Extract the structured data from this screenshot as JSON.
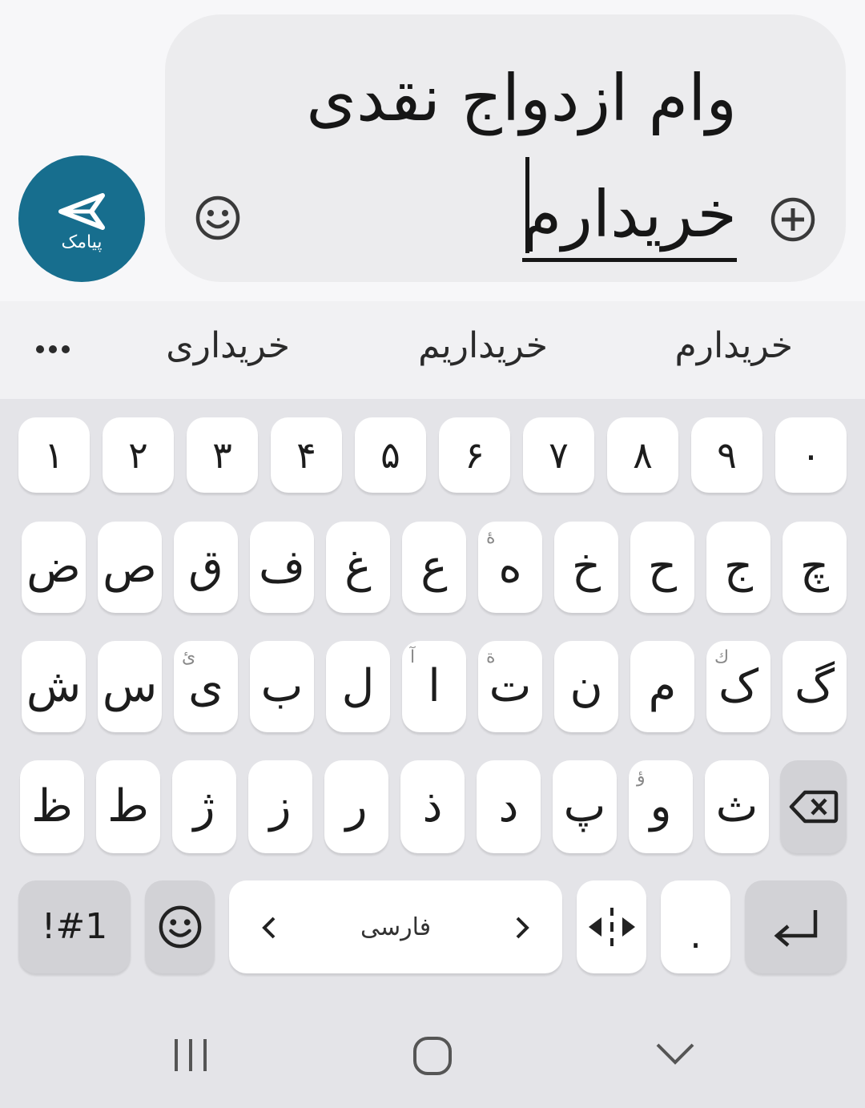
{
  "compose": {
    "send_label": "پیامک",
    "line1": "وام ازدواج  نقدی",
    "line2": "خریدارم"
  },
  "suggestions": [
    "خریدارم",
    "خریداریم",
    "خریداری"
  ],
  "keyboard": {
    "row_numbers": [
      "۰",
      "۹",
      "۸",
      "۷",
      "۶",
      "۵",
      "۴",
      "۳",
      "۲",
      "۱"
    ],
    "row1": [
      {
        "k": "چ",
        "s": ""
      },
      {
        "k": "ج",
        "s": ""
      },
      {
        "k": "ح",
        "s": ""
      },
      {
        "k": "خ",
        "s": ""
      },
      {
        "k": "ه",
        "s": "ۀ"
      },
      {
        "k": "ع",
        "s": ""
      },
      {
        "k": "غ",
        "s": ""
      },
      {
        "k": "ف",
        "s": ""
      },
      {
        "k": "ق",
        "s": ""
      },
      {
        "k": "ص",
        "s": ""
      },
      {
        "k": "ض",
        "s": ""
      }
    ],
    "row2": [
      {
        "k": "گ",
        "s": ""
      },
      {
        "k": "ک",
        "s": "ك"
      },
      {
        "k": "م",
        "s": ""
      },
      {
        "k": "ن",
        "s": ""
      },
      {
        "k": "ت",
        "s": "ة"
      },
      {
        "k": "ا",
        "s": "آ"
      },
      {
        "k": "ل",
        "s": ""
      },
      {
        "k": "ب",
        "s": ""
      },
      {
        "k": "ی",
        "s": "ئ"
      },
      {
        "k": "س",
        "s": ""
      },
      {
        "k": "ش",
        "s": ""
      }
    ],
    "row3": [
      {
        "k": "ث",
        "s": ""
      },
      {
        "k": "و",
        "s": "ؤ"
      },
      {
        "k": "پ",
        "s": ""
      },
      {
        "k": "د",
        "s": ""
      },
      {
        "k": "ذ",
        "s": ""
      },
      {
        "k": "ر",
        "s": ""
      },
      {
        "k": "ز",
        "s": ""
      },
      {
        "k": "ژ",
        "s": ""
      },
      {
        "k": "ط",
        "s": ""
      },
      {
        "k": "ظ",
        "s": ""
      }
    ],
    "symbols_label": "!#1",
    "space_label": "فارسی",
    "period": "."
  },
  "colors": {
    "accent": "#176e8e",
    "key_bg": "#ffffff",
    "kbd_bg": "#e4e4e8"
  },
  "icons": [
    "send-icon",
    "emoji-icon",
    "add-icon",
    "more-icon",
    "backspace-icon",
    "cursor-move-icon",
    "enter-icon",
    "recents-icon",
    "home-icon",
    "back-icon"
  ]
}
